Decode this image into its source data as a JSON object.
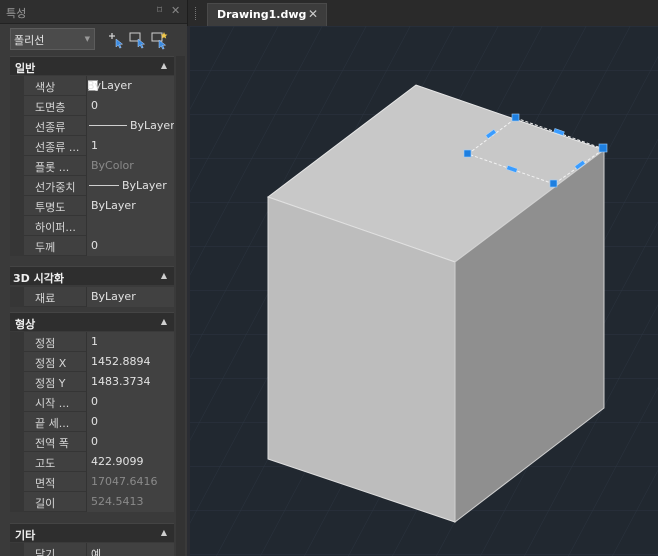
{
  "panel": {
    "title": "특성",
    "pin_icon": "pin-icon",
    "close_icon": "close-icon",
    "object_type": "폴리선",
    "toolbar": [
      "add-to-selection-icon",
      "select-objects-icon",
      "quick-select-icon"
    ]
  },
  "general": {
    "header": "일반",
    "rows": [
      {
        "name": "색상",
        "value": "ByLayer",
        "swatch": "#ffffff"
      },
      {
        "name": "도면층",
        "value": "0"
      },
      {
        "name": "선종류",
        "value": "ByLayer",
        "line": true
      },
      {
        "name": "선종류 ...",
        "value": "1"
      },
      {
        "name": "플롯 ...",
        "value": "ByColor",
        "dim": true
      },
      {
        "name": "선가중치",
        "value": "ByLayer",
        "line": true
      },
      {
        "name": "투명도",
        "value": "ByLayer"
      },
      {
        "name": "하이퍼...",
        "value": ""
      },
      {
        "name": "두께",
        "value": "0"
      }
    ]
  },
  "visual3d": {
    "header": "3D 시각화",
    "rows": [
      {
        "name": "재료",
        "value": "ByLayer"
      }
    ]
  },
  "geometry": {
    "header": "형상",
    "rows": [
      {
        "name": "정점",
        "value": "1"
      },
      {
        "name": "정점 X",
        "value": "1452.8894"
      },
      {
        "name": "정점 Y",
        "value": "1483.3734"
      },
      {
        "name": "시작 ...",
        "value": "0"
      },
      {
        "name": "끝 세...",
        "value": "0"
      },
      {
        "name": "전역 폭",
        "value": "0"
      },
      {
        "name": "고도",
        "value": "422.9099"
      },
      {
        "name": "면적",
        "value": "17047.6416",
        "dim": true
      },
      {
        "name": "길이",
        "value": "524.5413",
        "dim": true
      }
    ]
  },
  "misc": {
    "header": "기타",
    "rows": [
      {
        "name": "닫기",
        "value": "예"
      }
    ]
  },
  "document_tab": {
    "label": "Drawing1.dwg"
  },
  "colors": {
    "viewport_bg": "#212830",
    "grip_blue": "#1e7fe0",
    "box_top": "#c8c8c8",
    "box_left": "#bcbcbc",
    "box_right": "#8f8f8f"
  }
}
